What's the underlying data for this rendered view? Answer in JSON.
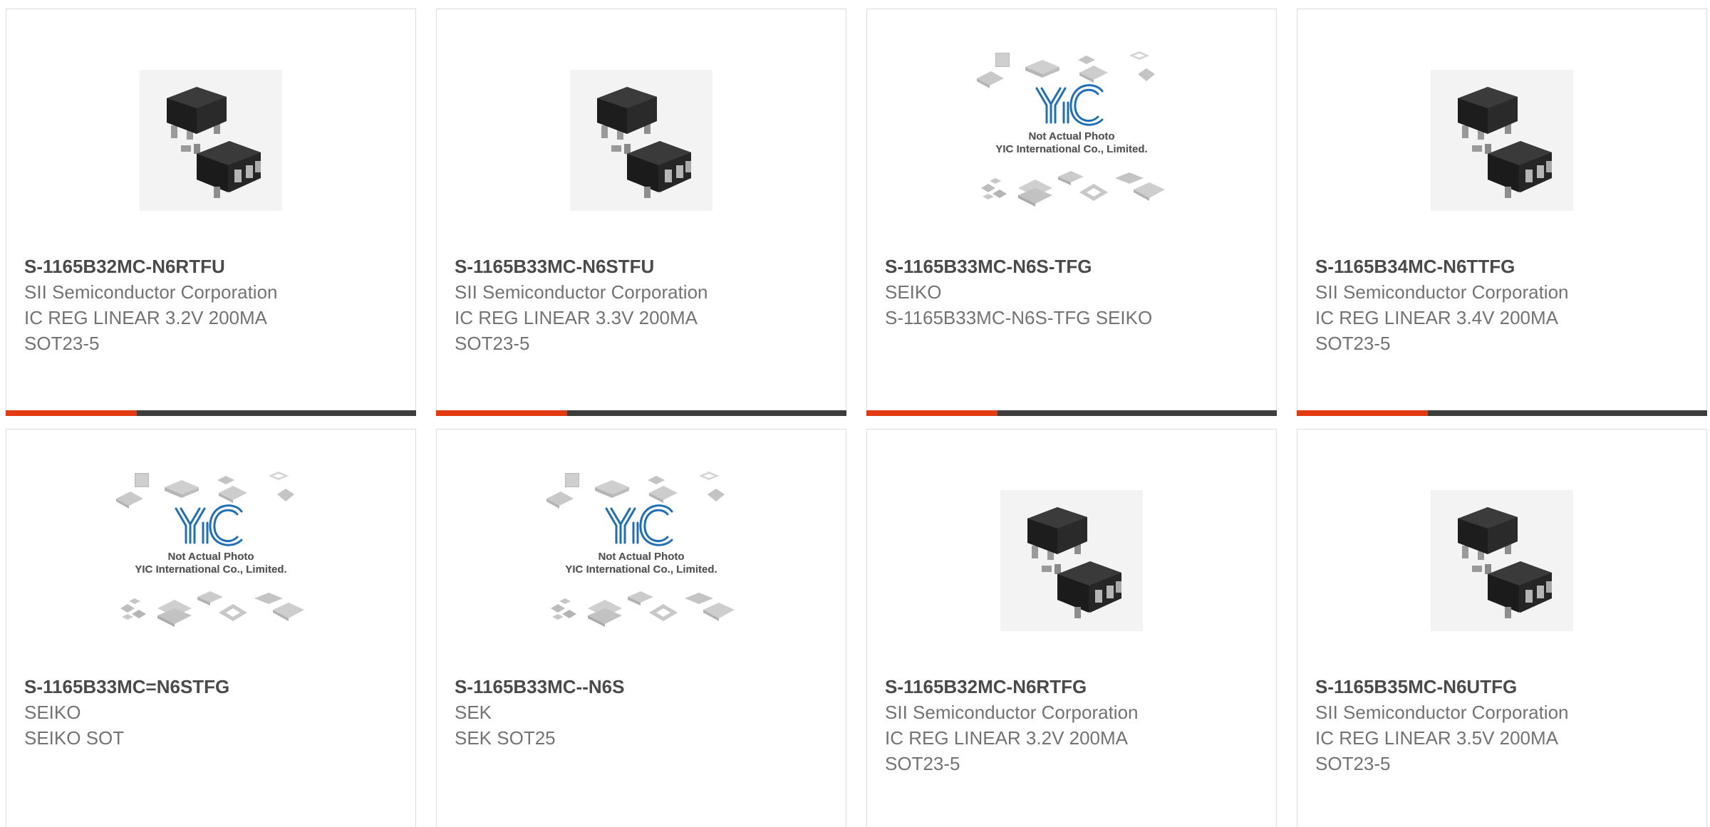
{
  "colors": {
    "accent": "#e23a12",
    "bar": "#3d3d3d",
    "border": "#dcdcdc",
    "part_number": "#4a4a4a",
    "text": "#737373",
    "logo_blue": "#1f6fb8"
  },
  "placeholder": {
    "caption1": "Not Actual Photo",
    "caption2": "YIC International Co., Limited.",
    "logo": "YIC"
  },
  "products": [
    {
      "part_number": "S-1165B32MC-N6RTFU",
      "manufacturer": "SII Semiconductor Corporation",
      "description": "IC REG LINEAR 3.2V 200MA",
      "package": "SOT23-5",
      "image": "sot23-5-chip-photo"
    },
    {
      "part_number": "S-1165B33MC-N6STFU",
      "manufacturer": "SII Semiconductor Corporation",
      "description": "IC REG LINEAR 3.3V 200MA",
      "package": "SOT23-5",
      "image": "sot23-5-chip-photo"
    },
    {
      "part_number": "S-1165B33MC-N6S-TFG",
      "manufacturer": "SEIKO",
      "description": "S-1165B33MC-N6S-TFG SEIKO",
      "package": "",
      "image": "not-actual-photo-placeholder"
    },
    {
      "part_number": "S-1165B34MC-N6TTFG",
      "manufacturer": "SII Semiconductor Corporation",
      "description": "IC REG LINEAR 3.4V 200MA",
      "package": "SOT23-5",
      "image": "sot23-5-chip-photo"
    },
    {
      "part_number": "S-1165B33MC=N6STFG",
      "manufacturer": "SEIKO",
      "description": "SEIKO SOT",
      "package": "",
      "image": "not-actual-photo-placeholder"
    },
    {
      "part_number": "S-1165B33MC--N6S",
      "manufacturer": "SEK",
      "description": "SEK SOT25",
      "package": "",
      "image": "not-actual-photo-placeholder"
    },
    {
      "part_number": "S-1165B32MC-N6RTFG",
      "manufacturer": "SII Semiconductor Corporation",
      "description": "IC REG LINEAR 3.2V 200MA",
      "package": "SOT23-5",
      "image": "sot23-5-chip-photo"
    },
    {
      "part_number": "S-1165B35MC-N6UTFG",
      "manufacturer": "SII Semiconductor Corporation",
      "description": "IC REG LINEAR 3.5V 200MA",
      "package": "SOT23-5",
      "image": "sot23-5-chip-photo"
    }
  ]
}
